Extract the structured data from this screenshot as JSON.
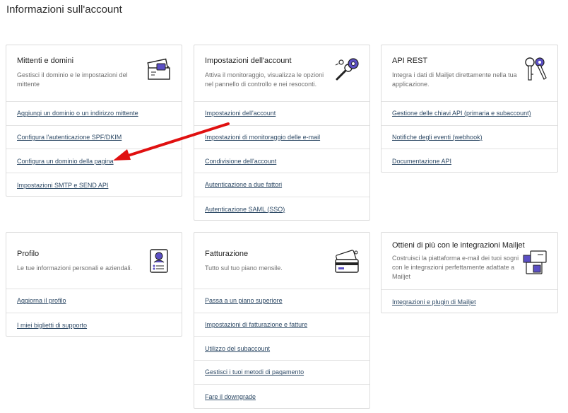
{
  "page": {
    "title": "Informazioni sull'account"
  },
  "cards": [
    {
      "title": "Mittenti e domini",
      "description": "Gestisci il dominio e le impostazioni del mittente",
      "icon": "envelope-mail-icon",
      "links": [
        "Aggiungi un dominio o un indirizzo mittente",
        "Configura l'autenticazione SPF/DKIM",
        "Configura un dominio della pagina",
        "Impostazioni SMTP e SEND API"
      ]
    },
    {
      "title": "Impostazioni dell'account",
      "description": "Attiva il monitoraggio, visualizza le opzioni nel pannello di controllo e nei resoconti.",
      "icon": "wrench-gear-icon",
      "links": [
        "Impostazioni dell'account",
        "Impostazioni di monitoraggio delle e-mail",
        "Condivisione dell'account",
        "Autenticazione a due fattori",
        "Autenticazione SAML (SSO)"
      ]
    },
    {
      "title": "API REST",
      "description": "Integra i dati di Mailjet direttamente nella tua applicazione.",
      "icon": "keys-icon",
      "links": [
        "Gestione delle chiavi API (primaria e subaccount)",
        "Notifiche degli eventi (webhook)",
        "Documentazione API"
      ]
    },
    {
      "title": "Profilo",
      "description": "Le tue informazioni personali e aziendali.",
      "icon": "profile-card-icon",
      "links": [
        "Aggiorna il profilo",
        "I miei biglietti di supporto"
      ]
    },
    {
      "title": "Fatturazione",
      "description": "Tutto sul tuo piano mensile.",
      "icon": "credit-card-icon",
      "links": [
        "Passa a un piano superiore",
        "Impostazioni di fatturazione e fatture",
        "Utilizzo del subaccount",
        "Gestisci i tuoi metodi di pagamento",
        "Fare il downgrade"
      ]
    },
    {
      "title": "Ottieni di più con le integrazioni Mailjet",
      "description": "Costruisci la piattaforma e-mail dei tuoi sogni con le integrazioni perfettamente adattate a Mailjet",
      "icon": "integrations-puzzle-icon",
      "links": [
        "Integrazioni e plugin di Mailjet"
      ]
    }
  ],
  "annotation": {
    "arrow_color": "#e01010",
    "icon_accent": "#5b4fc4"
  }
}
